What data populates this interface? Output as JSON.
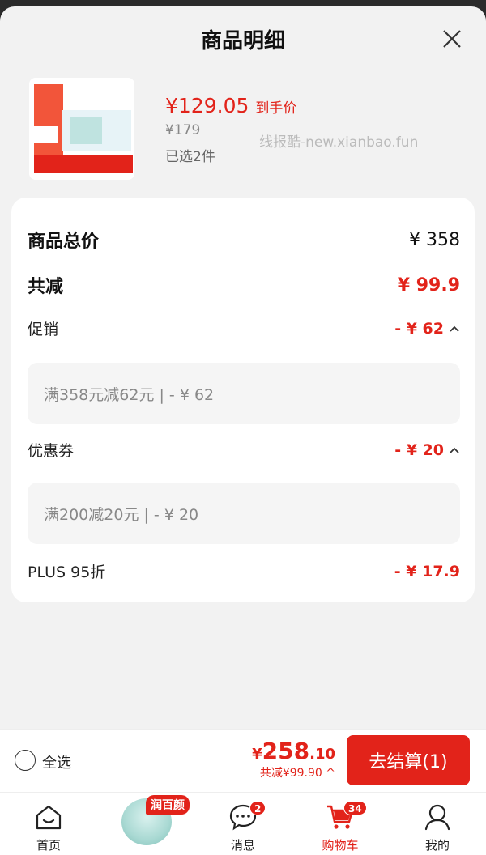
{
  "header": {
    "title": "商品明细"
  },
  "product": {
    "price": "¥129.05",
    "price_tag": "到手价",
    "original_price": "¥179",
    "selected_count": "已选2件",
    "watermark": "线报酷-new.xianbao.fun"
  },
  "summary": {
    "total_label": "商品总价",
    "total_value": "¥ 358",
    "discount_label": "共减",
    "discount_value": "¥ 99.9",
    "promo_label": "促销",
    "promo_value": "- ¥ 62",
    "promo_detail": "满358元减62元 | - ¥ 62",
    "coupon_label": "优惠券",
    "coupon_value": "- ¥ 20",
    "coupon_detail": "满200减20元 | - ¥ 20",
    "plus_label": "PLUS 95折",
    "plus_value": "- ¥ 17.9"
  },
  "footer": {
    "select_all": "全选",
    "total_yen": "¥",
    "total_int": "258",
    "total_dec": ".10",
    "total_sub": "共减¥99.90 ^",
    "checkout_label": "去结算(1)"
  },
  "tabbar": {
    "home": "首页",
    "promo_badge": "润百颜",
    "messages": "消息",
    "messages_badge": "2",
    "cart": "购物车",
    "cart_badge": "34",
    "mine": "我的"
  },
  "colors": {
    "accent": "#e2231a"
  }
}
